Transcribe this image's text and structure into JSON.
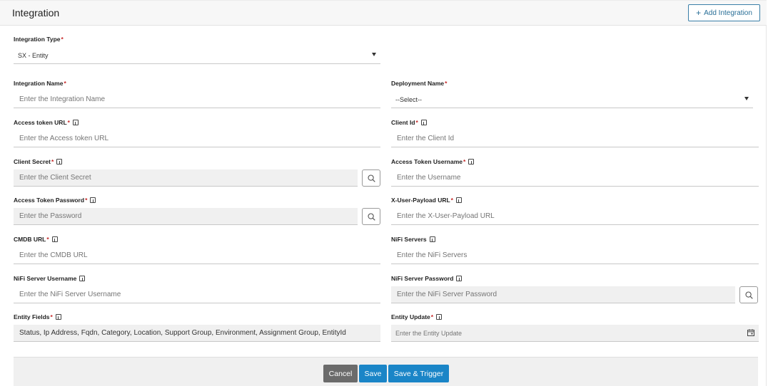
{
  "header": {
    "title": "Integration",
    "add_button": "Add Integration"
  },
  "fields": {
    "integration_type": {
      "label": "Integration Type",
      "value": "SX - Entity"
    },
    "integration_name": {
      "label": "Integration Name",
      "placeholder": "Enter the Integration Name"
    },
    "deployment_name": {
      "label": "Deployment Name",
      "value": "--Select--"
    },
    "access_token_url": {
      "label": "Access token URL",
      "placeholder": "Enter the Access token URL"
    },
    "client_id": {
      "label": "Client Id",
      "placeholder": "Enter the Client Id"
    },
    "client_secret": {
      "label": "Client Secret",
      "placeholder": "Enter the Client Secret"
    },
    "access_token_username": {
      "label": "Access Token Username",
      "placeholder": "Enter the Username"
    },
    "access_token_password": {
      "label": "Access Token Password",
      "placeholder": "Enter the Password"
    },
    "x_user_payload_url": {
      "label": "X-User-Payload URL",
      "placeholder": "Enter the X-User-Payload URL"
    },
    "cmdb_url": {
      "label": "CMDB URL",
      "placeholder": "Enter the CMDB URL"
    },
    "nifi_servers": {
      "label": "NiFi Servers",
      "placeholder": "Enter the NiFi Servers"
    },
    "nifi_server_username": {
      "label": "NiFi Server Username",
      "placeholder": "Enter the NiFi Server Username"
    },
    "nifi_server_password": {
      "label": "NiFi Server Password",
      "placeholder": "Enter the NiFi Server Password"
    },
    "entity_fields": {
      "label": "Entity Fields",
      "value": "Status, Ip Address, Fqdn, Category, Location, Support Group, Environment, Assignment Group, EntityId"
    },
    "entity_update": {
      "label": "Entity Update",
      "placeholder": "Enter the Entity Update"
    }
  },
  "footer": {
    "cancel": "Cancel",
    "save": "Save",
    "save_trigger": "Save & Trigger"
  },
  "colors": {
    "primary": "#1a85c7",
    "cancel": "#6b6b6b",
    "required": "#c62828"
  },
  "icons": [
    "plus-icon",
    "info-icon",
    "search-icon",
    "calendar-icon",
    "chevron-down-icon"
  ]
}
